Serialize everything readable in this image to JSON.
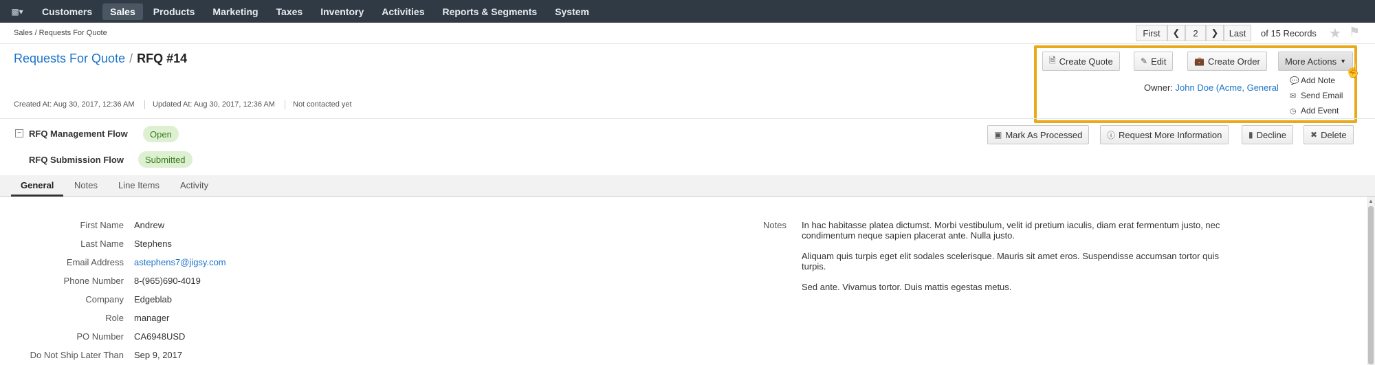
{
  "nav": {
    "logo_icon": "bar-chart-icon",
    "items": [
      "Customers",
      "Sales",
      "Products",
      "Marketing",
      "Taxes",
      "Inventory",
      "Activities",
      "Reports & Segments",
      "System"
    ]
  },
  "breadcrumb": "Sales / Requests For Quote",
  "pager": {
    "first": "First",
    "page": "2",
    "last": "Last",
    "records": "of 15 Records"
  },
  "title": {
    "section": "Requests For Quote",
    "record": "RFQ #14"
  },
  "actions": {
    "create_quote": "Create Quote",
    "edit": "Edit",
    "create_order": "Create Order",
    "more_actions": "More Actions"
  },
  "more_actions_menu": [
    "Add Note",
    "Send Email",
    "Add Event"
  ],
  "owner": {
    "label": "Owner:",
    "value": "John Doe (Acme, General"
  },
  "meta": {
    "created": "Created At: Aug 30, 2017, 12:36 AM",
    "updated": "Updated At: Aug 30, 2017, 12:36 AM",
    "contacted": "Not contacted yet"
  },
  "flows": [
    {
      "label": "RFQ Management Flow",
      "status": "Open"
    },
    {
      "label": "RFQ Submission Flow",
      "status": "Submitted"
    }
  ],
  "workflow_buttons": {
    "mark_processed": "Mark As Processed",
    "request_info": "Request More Information",
    "decline": "Decline",
    "delete": "Delete"
  },
  "tabs": [
    "General",
    "Notes",
    "Line Items",
    "Activity"
  ],
  "fields": [
    {
      "label": "First Name",
      "value": "Andrew"
    },
    {
      "label": "Last Name",
      "value": "Stephens"
    },
    {
      "label": "Email Address",
      "value": "astephens7@jigsy.com"
    },
    {
      "label": "Phone Number",
      "value": "8-(965)690-4019"
    },
    {
      "label": "Company",
      "value": "Edgeblab"
    },
    {
      "label": "Role",
      "value": "manager"
    },
    {
      "label": "PO Number",
      "value": "CA6948USD"
    },
    {
      "label": "Do Not Ship Later Than",
      "value": "Sep 9, 2017"
    }
  ],
  "notes": {
    "label": "Notes",
    "paragraphs": [
      "In hac habitasse platea dictumst. Morbi vestibulum, velit id pretium iaculis, diam erat fermentum justo, nec condimentum neque sapien placerat ante. Nulla justo.",
      "Aliquam quis turpis eget elit sodales scelerisque. Mauris sit amet eros. Suspendisse accumsan tortor quis turpis.",
      "Sed ante. Vivamus tortor. Duis mattis egestas metus."
    ]
  },
  "colors": {
    "nav_bg": "#2f3a45",
    "link": "#1a73c9",
    "highlight": "#e8a91b",
    "badge_bg": "#ddf0d2"
  }
}
